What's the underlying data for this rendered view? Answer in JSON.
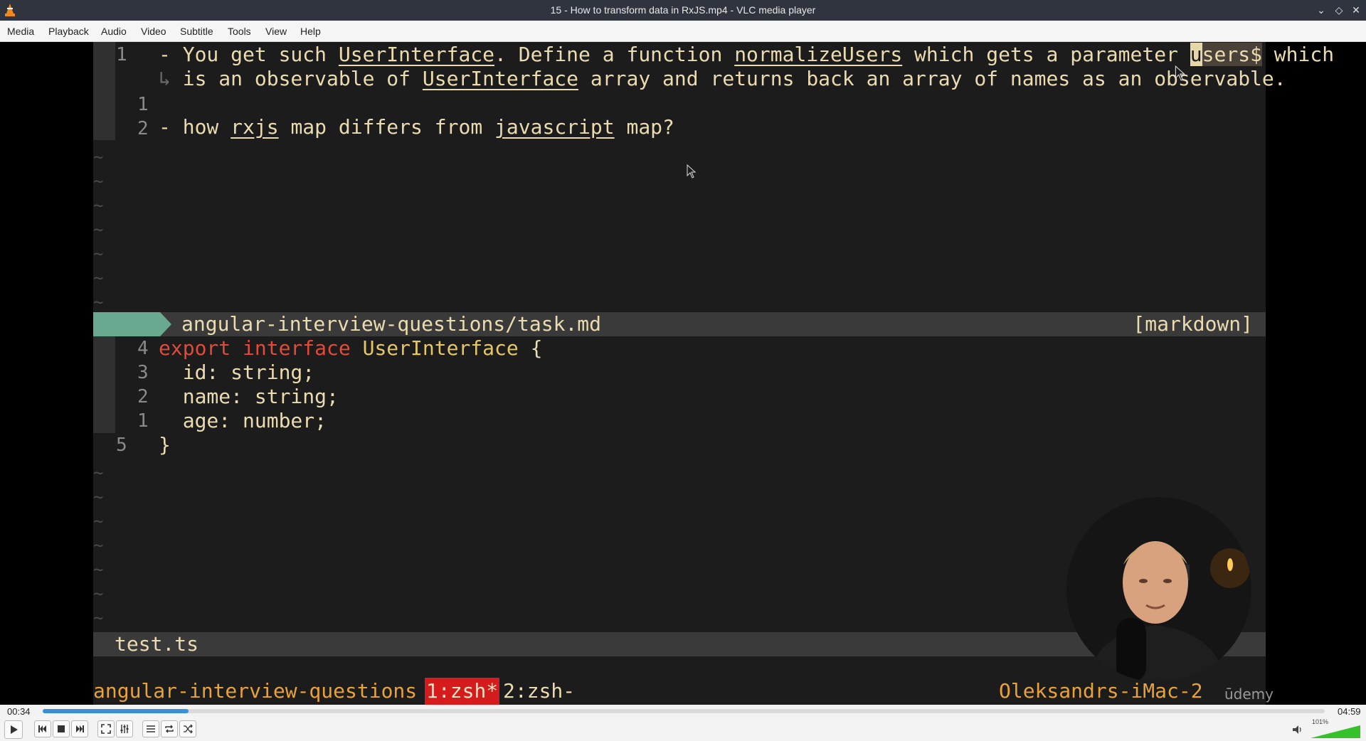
{
  "window": {
    "title": "15 - How to transform data in RxJS.mp4 - VLC media player",
    "controls": [
      "minimize",
      "maximize",
      "close"
    ]
  },
  "menu": [
    "Media",
    "Playback",
    "Audio",
    "Video",
    "Subtitle",
    "Tools",
    "View",
    "Help"
  ],
  "editor_top": {
    "line1_num": "1",
    "line1_parts": [
      "- You get such ",
      "UserInterface",
      ". Define a function ",
      "normalizeUsers",
      " which gets a parameter "
    ],
    "cursor_char": "u",
    "highlighted_rest": "sers$",
    "line1_end": " which",
    "wrap_marker": "↳",
    "line1_wrap_parts": [
      "is an observable of ",
      "UserInterface",
      " array and returns back an array of names as an observable."
    ],
    "line2_num": "1",
    "line3_num": "2",
    "line3_parts": [
      "- how ",
      "rxjs",
      " map differs from ",
      "javascript",
      " map?"
    ]
  },
  "status_top": {
    "filename": "angular-interview-questions/task.md",
    "filetype": "[markdown]"
  },
  "editor_bottom": {
    "lines": [
      {
        "num": "4",
        "kw1": "export",
        "kw2": "interface",
        "type": "UserInterface",
        "rest": " {"
      },
      {
        "num": "3",
        "text": "  id: string;"
      },
      {
        "num": "2",
        "text": "  name: string;"
      },
      {
        "num": "1",
        "text": "  age: number;"
      },
      {
        "num": "5",
        "text": "}"
      }
    ]
  },
  "status_bottom": {
    "filename": "test.ts"
  },
  "tmux": {
    "session": "angular-interview-questions §",
    "win1": "1:zsh*",
    "win2": "2:zsh-",
    "host": "Oleksandrs-iMac-2 21:25"
  },
  "watermark": "ūdemy",
  "player": {
    "elapsed": "00:34",
    "total": "04:59",
    "progress": 0.114,
    "volume_label": "101%",
    "volume": 1.01
  },
  "colors": {
    "progress": "#3a8fd6",
    "volume": "#35c12a",
    "vim_keyword": "#e24a3a",
    "tmux_accent": "#e8a23a"
  },
  "icons": [
    "vlc-cone-icon",
    "play-icon",
    "previous-icon",
    "stop-icon",
    "next-icon",
    "fullscreen-icon",
    "extended-settings-icon",
    "playlist-icon",
    "loop-icon",
    "shuffle-icon",
    "volume-icon"
  ]
}
